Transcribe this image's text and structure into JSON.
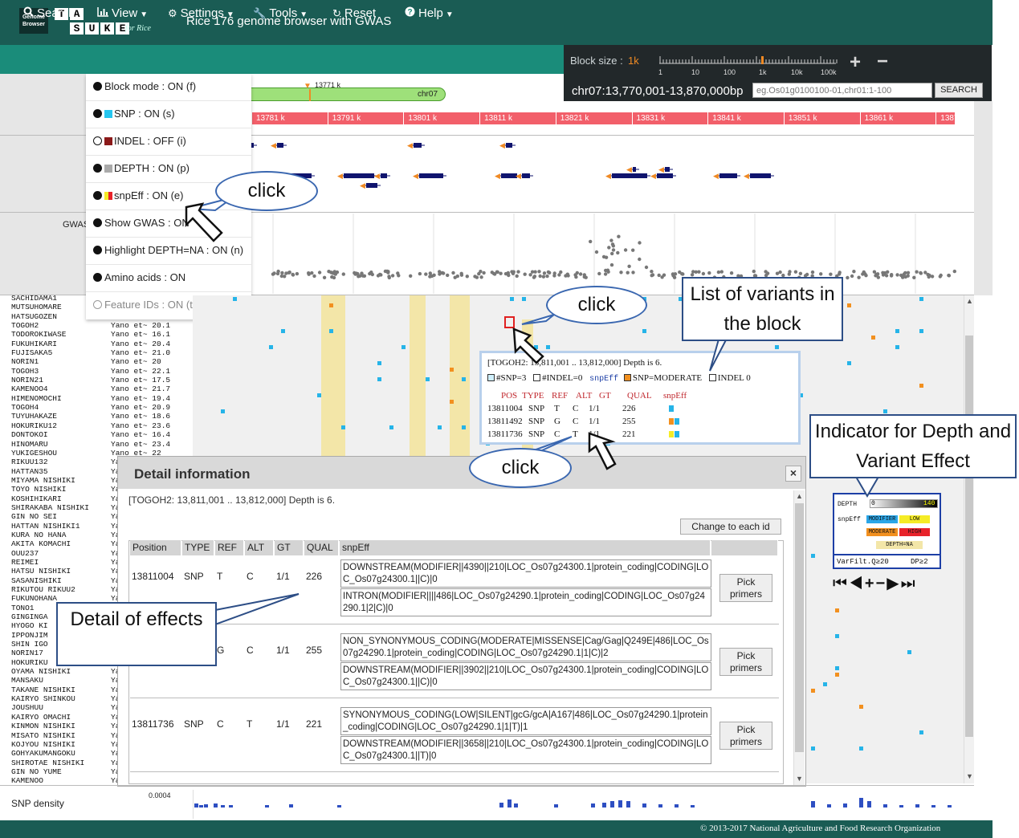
{
  "header": {
    "logo_gb": "Genome Browser",
    "logo_letters": [
      "T",
      "A",
      "S",
      "U",
      "K",
      "E"
    ],
    "logo_suffix": "for Rice",
    "title": "Rice 176 genome browser with GWAS"
  },
  "nav": {
    "search": "Search",
    "view": "View",
    "settings": "Settings",
    "tools": "Tools",
    "reset": "Reset",
    "help": "Help"
  },
  "block_panel": {
    "label": "Block size :",
    "value": "1k",
    "scale_labels": [
      "1",
      "10",
      "100",
      "1k",
      "10k",
      "100k"
    ],
    "locus": "chr07:13,770,001-13,870,000bp",
    "search_placeholder": "eg.Os01g0100100-01,chr01:1-100",
    "search_button": "SEARCH"
  },
  "view_menu": [
    {
      "label": "Block mode : ON (f)",
      "marker": "dot"
    },
    {
      "label": "SNP : ON (s)",
      "marker": "dot+cyan"
    },
    {
      "label": "INDEL : OFF (i)",
      "marker": "hollow+darkred"
    },
    {
      "label": "DEPTH : ON (p)",
      "marker": "dot+gray"
    },
    {
      "label": "snpEff : ON (e)",
      "marker": "dot+multi"
    },
    {
      "label": "Show GWAS : ON",
      "marker": "dot"
    },
    {
      "label": "Highlight DEPTH=NA : ON (n)",
      "marker": "dot"
    },
    {
      "label": "Amino acids : ON",
      "marker": "dot"
    },
    {
      "label": "Feature IDs : ON (t)",
      "marker": "hollowgray"
    }
  ],
  "chromosome": {
    "label": "chr07",
    "position": "13771 k"
  },
  "ruler_ticks": [
    "13781 k",
    "13791 k",
    "13801 k",
    "13811 k",
    "13821 k",
    "13831 k",
    "13841 k",
    "13851 k",
    "13861 k",
    "13871 k"
  ],
  "gwas_label": "GWAS",
  "varieties": [
    {
      "name": "SACHIDAMA1",
      "ab": ""
    },
    {
      "name": "MUTSUHOMARE",
      "ab": ""
    },
    {
      "name": "HATSUGOZEN",
      "ab": ""
    },
    {
      "name": "TOGOH2",
      "ab": "Yano et~ 20.1"
    },
    {
      "name": "TODOROKIWASE",
      "ab": "Yano et~ 16.1"
    },
    {
      "name": "FUKUHIKARI",
      "ab": "Yano et~ 20.4"
    },
    {
      "name": "FUJISAKA5",
      "ab": "Yano et~ 21.0"
    },
    {
      "name": "NORIN1",
      "ab": "Yano et~ 20"
    },
    {
      "name": "TOGOH3",
      "ab": "Yano et~ 22.1"
    },
    {
      "name": "NORIN21",
      "ab": "Yano et~ 17.5"
    },
    {
      "name": "KAMENOO4",
      "ab": "Yano et~ 21.7"
    },
    {
      "name": "HIMENOMOCHI",
      "ab": "Yano et~ 19.4"
    },
    {
      "name": "TOGOH4",
      "ab": "Yano et~ 20.9"
    },
    {
      "name": "TUYUHAKAZE",
      "ab": "Yano et~ 18.6"
    },
    {
      "name": "HOKURIKU12",
      "ab": "Yano et~ 23.6"
    },
    {
      "name": "DONTOKOI",
      "ab": "Yano et~ 16.4"
    },
    {
      "name": "HINOMARU",
      "ab": "Yano et~ 23.4"
    },
    {
      "name": "YUKIGESHOU",
      "ab": "Yano et~ 22"
    },
    {
      "name": "RIKUU132",
      "ab": "Ya"
    },
    {
      "name": "HATTAN35",
      "ab": "Ya"
    },
    {
      "name": "MIYAMA NISHIKI",
      "ab": "Ya"
    },
    {
      "name": "TOYO NISHIKI",
      "ab": "Ya"
    },
    {
      "name": "KOSHIHIKARI",
      "ab": "Ya"
    },
    {
      "name": "SHIRAKABA NISHIKI",
      "ab": "Ya"
    },
    {
      "name": "GIN NO SEI",
      "ab": "Ya"
    },
    {
      "name": "HATTAN NISHIKI1",
      "ab": "Ya"
    },
    {
      "name": "KURA NO HANA",
      "ab": "Ya"
    },
    {
      "name": "AKITA KOMACHI",
      "ab": "Ya"
    },
    {
      "name": "OUU237",
      "ab": "Ya"
    },
    {
      "name": "REIMEI",
      "ab": "Ya"
    },
    {
      "name": "HATSU NISHIKI",
      "ab": "Ya"
    },
    {
      "name": "SASANISHIKI",
      "ab": "Ya"
    },
    {
      "name": "RIKUTOU RIKUU2",
      "ab": "Ya"
    },
    {
      "name": "FUKUNOHANA",
      "ab": "Ya"
    },
    {
      "name": "TONO1",
      "ab": "Ya"
    },
    {
      "name": "GINGINGA",
      "ab": "Ya"
    },
    {
      "name": "HYOGO KI",
      "ab": "Ya"
    },
    {
      "name": "IPPONJIM",
      "ab": "Ya"
    },
    {
      "name": "SHIN IGO",
      "ab": "Ya"
    },
    {
      "name": "NORIN17",
      "ab": "Ya"
    },
    {
      "name": "HOKURIKU",
      "ab": "Ya"
    },
    {
      "name": "OYAMA NISHIKI",
      "ab": "Ya"
    },
    {
      "name": "MANSAKU",
      "ab": "Ya"
    },
    {
      "name": "TAKANE NISHIKI",
      "ab": "Ya"
    },
    {
      "name": "KAIRYO SHINKOU",
      "ab": "Ya"
    },
    {
      "name": "JOUSHUU",
      "ab": "Ya"
    },
    {
      "name": "KAIRYO OMACHI",
      "ab": "Ya"
    },
    {
      "name": "KINMON NISHIKI",
      "ab": "Ya"
    },
    {
      "name": "MISATO NISHIKI",
      "ab": "Ya"
    },
    {
      "name": "KOJYOU NISHIKI",
      "ab": "Ya"
    },
    {
      "name": "GOHYAKUMANGOKU",
      "ab": "Ya"
    },
    {
      "name": "SHIROTAE NISHIKI",
      "ab": "Ya"
    },
    {
      "name": "GIN NO YUME",
      "ab": "Ya"
    },
    {
      "name": "KAMENOO",
      "ab": "Ya"
    }
  ],
  "snp_popup": {
    "title": "[TOGOH2: 13,811,001 .. 13,812,000] Depth is 6.",
    "summary_snp": "#SNP=3",
    "summary_indel": "#INDEL=0",
    "summary_snpeff": "snpEff",
    "summary_moderate": "SNP=MODERATE",
    "summary_indel2": "INDEL 0",
    "headers": [
      "POS",
      "TYPE",
      "REF",
      "ALT",
      "GT",
      "QUAL",
      "snpEff"
    ],
    "rows": [
      {
        "pos": "13811004",
        "type": "SNP",
        "ref": "T",
        "alt": "C",
        "gt": "1/1",
        "qual": "226"
      },
      {
        "pos": "13811492",
        "type": "SNP",
        "ref": "G",
        "alt": "C",
        "gt": "1/1",
        "qual": "255"
      },
      {
        "pos": "13811736",
        "type": "SNP",
        "ref": "C",
        "alt": "T",
        "gt": "1/1",
        "qual": "221"
      }
    ]
  },
  "detail": {
    "title": "Detail information",
    "close": "×",
    "subtitle": "[TOGOH2: 13,811,001 .. 13,812,000] Depth is 6.",
    "change_button": "Change to each id",
    "headers": [
      "Position",
      "TYPE",
      "REF",
      "ALT",
      "GT",
      "QUAL",
      "snpEff"
    ],
    "pick_label_1": "Pick",
    "pick_label_2": "primers",
    "rows": [
      {
        "position": "13811004",
        "type": "SNP",
        "ref": "T",
        "alt": "C",
        "gt": "1/1",
        "qual": "226",
        "effects": [
          "DOWNSTREAM(MODIFIER||4390||210|LOC_Os07g24300.1|protein_coding|CODING|LOC_Os07g24300.1||C)|0",
          "INTRON(MODIFIER||||486|LOC_Os07g24290.1|protein_coding|CODING|LOC_Os07g24290.1|2|C)|0"
        ]
      },
      {
        "position": "",
        "type": "",
        "ref": "G",
        "alt": "C",
        "gt": "1/1",
        "qual": "255",
        "effects": [
          "NON_SYNONYMOUS_CODING(MODERATE|MISSENSE|Cag/Gag|Q249E|486|LOC_Os07g24290.1|protein_coding|CODING|LOC_Os07g24290.1|1|C)|2",
          "DOWNSTREAM(MODIFIER||3902||210|LOC_Os07g24300.1|protein_coding|CODING|LOC_Os07g24300.1||C)|0"
        ]
      },
      {
        "position": "13811736",
        "type": "SNP",
        "ref": "C",
        "alt": "T",
        "gt": "1/1",
        "qual": "221",
        "effects": [
          "SYNONYMOUS_CODING(LOW|SILENT|gcG/gcA|A167|486|LOC_Os07g24290.1|protein_coding|CODING|LOC_Os07g24290.1|1|T)|1",
          "DOWNSTREAM(MODIFIER||3658||210|LOC_Os07g24300.1|protein_coding|CODING|LOC_Os07g24300.1||T)|0"
        ]
      }
    ]
  },
  "legend": {
    "depth": "DEPTH",
    "depth_min": "0",
    "depth_max": "140",
    "snpeff": "snpEff",
    "modifier": "MODIFIER",
    "low": "LOW",
    "moderate": "MODERATE",
    "high": "HIGH",
    "depth_na": "DEPTH=NA",
    "varfilt": "VarFilt.Q≥20",
    "dp": "DP≥2",
    "colors": {
      "modifier": "#2aa6e8",
      "low": "#f5ec26",
      "moderate": "#f2901f",
      "high": "#e8232a",
      "depth_na": "#f3e6a8"
    }
  },
  "density": {
    "label": "SNP density",
    "value": "0.0004"
  },
  "footer": "© 2013-2017 National Agriculture and Food Research Organization",
  "annotations": {
    "click1": "click",
    "click2": "click",
    "click3": "click",
    "list_variants": "List of variants in the block",
    "indicator": "Indicator for Depth and Variant Effect",
    "detail_effects": "Detail of effects"
  },
  "colors": {
    "header": "#1a5c54",
    "nav": "#1a8c7a",
    "snp": "#26b4e8",
    "moderate": "#f2901f",
    "ruler": "#f25f6a"
  }
}
